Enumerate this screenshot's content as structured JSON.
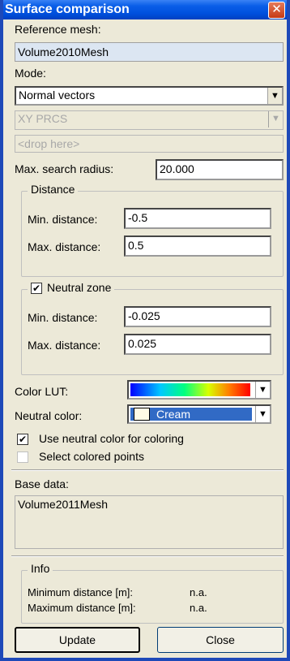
{
  "window": {
    "title": "Surface comparison",
    "close_glyph": "✕"
  },
  "reference": {
    "label": "Reference mesh:",
    "value": "Volume2010Mesh"
  },
  "mode": {
    "label": "Mode:",
    "selected": "Normal vectors"
  },
  "coord_system": {
    "selected": "XY PRCS"
  },
  "drop": {
    "placeholder": "<drop here>"
  },
  "search_radius": {
    "label": "Max. search radius:",
    "value": "20.000"
  },
  "distance": {
    "legend": "Distance",
    "min_label": "Min. distance:",
    "min_value": "-0.5",
    "max_label": "Max. distance:",
    "max_value": "0.5"
  },
  "neutral_zone": {
    "legend": "Neutral zone",
    "checked": true,
    "min_label": "Min. distance:",
    "min_value": "-0.025",
    "max_label": "Max. distance:",
    "max_value": "0.025"
  },
  "color_lut": {
    "label": "Color LUT:"
  },
  "neutral_color": {
    "label": "Neutral color:",
    "selected": "Cream"
  },
  "options": {
    "use_neutral_label": "Use neutral color for coloring",
    "use_neutral_checked": true,
    "select_colored_label": "Select colored points",
    "select_colored_checked": false
  },
  "base_data": {
    "label": "Base data:",
    "value": "Volume2011Mesh"
  },
  "info": {
    "legend": "Info",
    "min_label": "Minimum distance [m]:",
    "min_value": "n.a.",
    "max_label": "Maximum distance [m]:",
    "max_value": "n.a."
  },
  "buttons": {
    "update": "Update",
    "close": "Close"
  },
  "icons": {
    "check": "check-icon",
    "dropdown_arrow": "dropdown-arrow-icon"
  },
  "colors": {
    "titlebar": "#0a5ee8",
    "neutral_swatch": "#fffbe6",
    "selection": "#316ac5"
  }
}
